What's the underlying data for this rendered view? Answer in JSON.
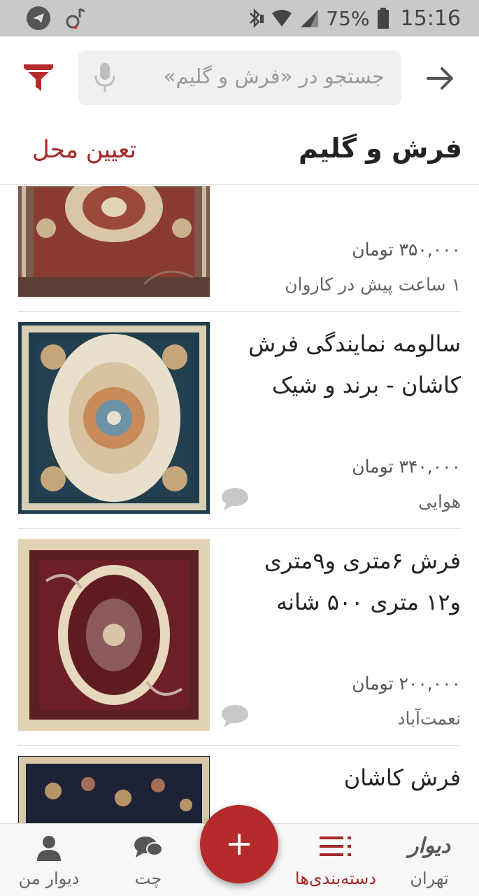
{
  "status_bar": {
    "battery": "75%",
    "time": "15:16"
  },
  "header": {
    "search_placeholder": "جستجو در «فرش و گلیم»",
    "title": "فرش و گلیم",
    "location_link": "تعیین محل"
  },
  "listings": [
    {
      "title": "",
      "price": "۳۵۰,۰۰۰ تومان",
      "meta": "۱ ساعت پیش در کاروان",
      "has_chat": false
    },
    {
      "title": "سالومه نمایندگی فرش کاشان - برند و شیک",
      "price": "۳۴۰,۰۰۰ تومان",
      "meta": "هوایی",
      "has_chat": true
    },
    {
      "title": "فرش ۶متری و۹متری و۱۲ متری ۵۰۰ شانه",
      "price": "۲۰۰,۰۰۰ تومان",
      "meta": "نعمت‌آباد",
      "has_chat": true
    },
    {
      "title": "فرش کاشان",
      "price": "",
      "meta": "",
      "has_chat": false
    }
  ],
  "bottom_nav": {
    "brand": "دیوار",
    "city": "تهران",
    "categories": "دسته‌بندی‌ها",
    "chat": "چت",
    "my_divar": "دیوار من",
    "fab_symbol": "+"
  },
  "colors": {
    "accent": "#a62626",
    "fab": "#b52b2b",
    "status_bar": "#c9c9c9"
  },
  "icons": {
    "filter": "filter-icon",
    "mic": "mic-icon",
    "back": "arrow-right-icon",
    "chat_bubble": "chat-bubble-icon",
    "categories": "list-icon",
    "user": "user-icon",
    "telegram": "telegram-icon"
  }
}
